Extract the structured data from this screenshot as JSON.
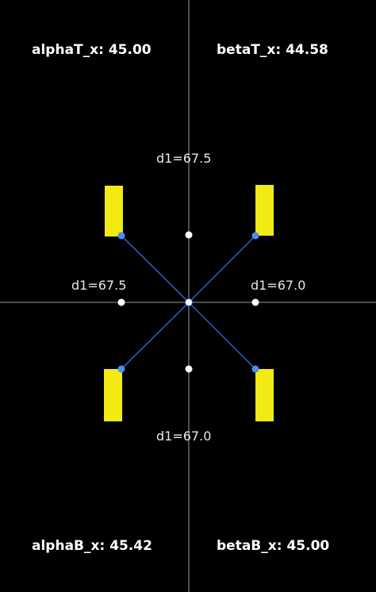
{
  "angles": {
    "alphaT": {
      "label": "alphaT_x:",
      "value": "45.00"
    },
    "betaT": {
      "label": "betaT_x:",
      "value": "44.58"
    },
    "alphaB": {
      "label": "alphaB_x:",
      "value": "45.42"
    },
    "betaB": {
      "label": "betaB_x:",
      "value": "45.00"
    }
  },
  "distances": {
    "top": "d1=67.5",
    "left": "d1=67.5",
    "right": "d1=67.0",
    "bottom": "d1=67.0"
  },
  "colors": {
    "background": "#000000",
    "axis": "#9a9a9a",
    "marker": "#f2ea12",
    "link": "#2f6fd8",
    "joint": "#4a8ef0",
    "point": "#ffffff"
  }
}
